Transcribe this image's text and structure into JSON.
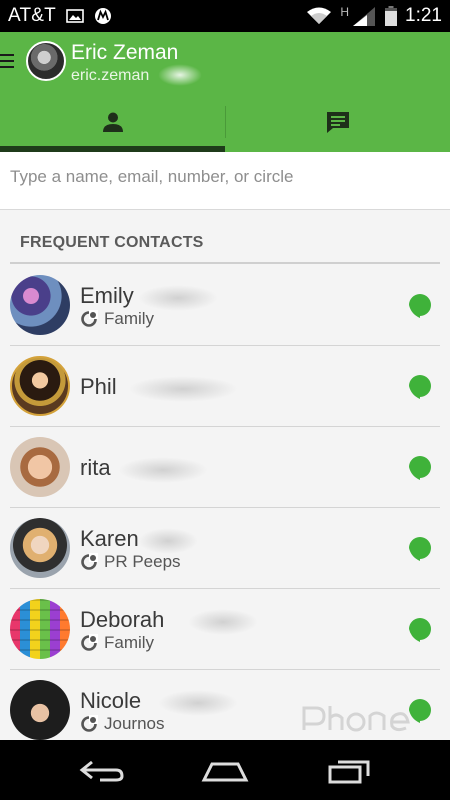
{
  "status_bar": {
    "carrier": "AT&T",
    "time": "1:21",
    "network_type": "H",
    "icons": [
      "image-icon",
      "motorola-icon",
      "wifi-icon",
      "signal-icon",
      "battery-icon"
    ]
  },
  "header": {
    "user_name": "Eric Zeman",
    "user_email": "eric.zeman",
    "tabs": [
      {
        "icon": "person-icon",
        "active": true
      },
      {
        "icon": "chat-icon",
        "active": false
      }
    ],
    "background_color": "#5bb646"
  },
  "search": {
    "placeholder": "Type a name, email, number, or circle"
  },
  "section": {
    "title": "FREQUENT CONTACTS"
  },
  "contacts": [
    {
      "name": "Emily",
      "circle": "Family",
      "avatar": "photo"
    },
    {
      "name": "Phil",
      "circle": "",
      "avatar": "photo"
    },
    {
      "name": "rita",
      "circle": "",
      "avatar": "photo"
    },
    {
      "name": "Karen",
      "circle": "PR Peeps",
      "avatar": "photo"
    },
    {
      "name": "Deborah",
      "circle": "Family",
      "avatar": "photo"
    },
    {
      "name": "Nicole",
      "circle": "Journos",
      "avatar": "photo"
    }
  ],
  "nav_bar": {
    "buttons": [
      "back-icon",
      "home-icon",
      "recents-icon"
    ]
  },
  "colors": {
    "accent": "#5bb646",
    "hangout_green": "#3fb23a",
    "tab_indicator": "#1f3b1a"
  }
}
